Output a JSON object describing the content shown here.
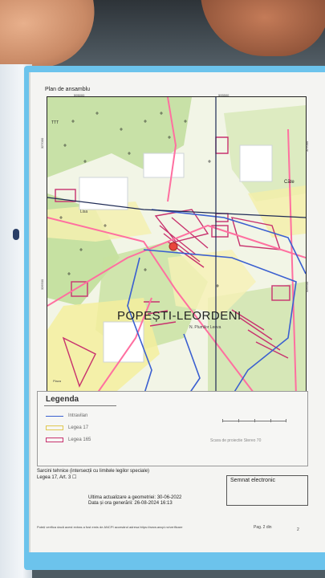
{
  "document": {
    "heading": "Plan de ansamblu",
    "map": {
      "place_name": "POPEȘTI-LEORDENI",
      "labels": {
        "top_left": "TTT",
        "top_right": "Căte",
        "street": "N. Plumilor Leova",
        "road": "Lisa",
        "corner": "Plaza"
      },
      "coords": {
        "top_left": "595000",
        "top_right": "595500",
        "bottom_left": "595000",
        "bottom_right": "595500",
        "left_upper": "327000",
        "left_lower": "326500",
        "right_upper": "327000",
        "right_lower": "326500"
      }
    },
    "legend": {
      "title": "Legenda",
      "items": [
        {
          "label": "Intravilan",
          "color": "#3a5fd0",
          "style": "line"
        },
        {
          "label": "Legea 17",
          "color": "#e0c850",
          "style": "box"
        },
        {
          "label": "Legea 165",
          "color": "#c8326e",
          "style": "box"
        }
      ],
      "scale_caption": "Scara de proiectie Stereo 70"
    },
    "technical_title": "Sarcini tehnice (intersecții cu limitele legilor speciale)",
    "technical_line": "Legea 17, Art. 3",
    "checkbox_symbol": "☐",
    "signature_label": "Semnat electronic",
    "updated": "Ultima actualizare a geometriei: 30-06-2022",
    "generated": "Data și ora generării: 26-08-2024 16:13",
    "footer_note": "Puteți verifica dacă acest extras a fost emis de ANCPI accesând adresa https://www.ancpi.ro/verificare",
    "page": "Pag. 2 din",
    "page_number": "2"
  },
  "colors": {
    "intravilan": "#3a5fd0",
    "legea17": "#e0c850",
    "legea165": "#c8326e",
    "road": "#ff6fa0",
    "vegetation": "#b7d98b",
    "yellow_area": "#f4f0b0"
  }
}
